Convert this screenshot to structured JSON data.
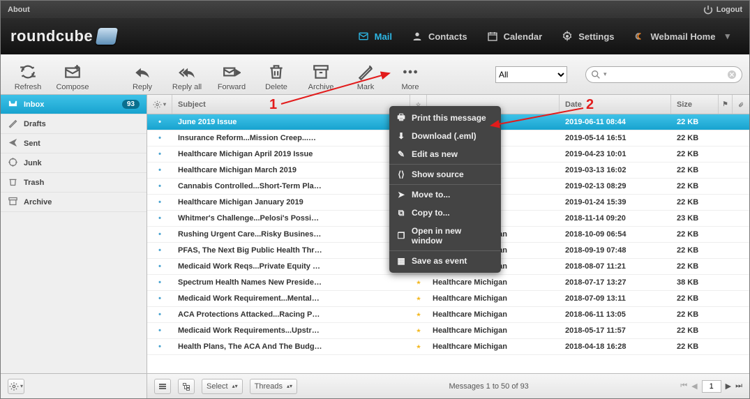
{
  "topbar": {
    "about": "About",
    "logout": "Logout"
  },
  "brand": "roundcube",
  "nav": {
    "mail": "Mail",
    "contacts": "Contacts",
    "calendar": "Calendar",
    "settings": "Settings",
    "webmail": "Webmail Home"
  },
  "toolbar": {
    "refresh": "Refresh",
    "compose": "Compose",
    "reply": "Reply",
    "replyall": "Reply all",
    "forward": "Forward",
    "delete": "Delete",
    "archive": "Archive",
    "mark": "Mark",
    "more": "More"
  },
  "filter_selected": "All",
  "folders": [
    {
      "key": "inbox",
      "label": "Inbox",
      "badge": "93",
      "active": true
    },
    {
      "key": "drafts",
      "label": "Drafts"
    },
    {
      "key": "sent",
      "label": "Sent"
    },
    {
      "key": "junk",
      "label": "Junk"
    },
    {
      "key": "trash",
      "label": "Trash"
    },
    {
      "key": "archive",
      "label": "Archive"
    }
  ],
  "columns": {
    "subject": "Subject",
    "date": "Date",
    "size": "Size"
  },
  "messages": [
    {
      "subject": "June 2019 Issue",
      "from": "",
      "date": "2019-06-11 08:44",
      "size": "22 KB",
      "starred": false,
      "selected": true
    },
    {
      "subject": "Insurance Reform...Mission Creep...…",
      "from": "",
      "date": "2019-05-14 16:51",
      "size": "22 KB",
      "starred": false
    },
    {
      "subject": "Healthcare Michigan April 2019 Issue",
      "from": "",
      "date": "2019-04-23 10:01",
      "size": "22 KB",
      "starred": false
    },
    {
      "subject": "Healthcare Michigan March 2019",
      "from": "",
      "date": "2019-03-13 16:02",
      "size": "22 KB",
      "starred": false
    },
    {
      "subject": "Cannabis Controlled...Short-Term Pla…",
      "from": "",
      "date": "2019-02-13 08:29",
      "size": "22 KB",
      "starred": false
    },
    {
      "subject": "Healthcare Michigan January 2019",
      "from": "",
      "date": "2019-01-24 15:39",
      "size": "22 KB",
      "starred": false
    },
    {
      "subject": "Whitmer's Challenge...Pelosi's Possi…",
      "from": "",
      "date": "2018-11-14 09:20",
      "size": "23 KB",
      "starred": false
    },
    {
      "subject": "Rushing Urgent Care...Risky Busines…",
      "from": "Healthcare Michigan",
      "date": "2018-10-09 06:54",
      "size": "22 KB",
      "starred": true
    },
    {
      "subject": "PFAS, The Next Big Public Health Thr…",
      "from": "Healthcare Michigan",
      "date": "2018-09-19 07:48",
      "size": "22 KB",
      "starred": true
    },
    {
      "subject": "Medicaid Work Reqs...Private Equity …",
      "from": "Healthcare Michigan",
      "date": "2018-08-07 11:21",
      "size": "22 KB",
      "starred": true
    },
    {
      "subject": "Spectrum Health Names New Preside…",
      "from": "Healthcare Michigan",
      "date": "2018-07-17 13:27",
      "size": "38 KB",
      "starred": true
    },
    {
      "subject": "Medicaid Work Requirement...Mental…",
      "from": "Healthcare Michigan",
      "date": "2018-07-09 13:11",
      "size": "22 KB",
      "starred": true
    },
    {
      "subject": "ACA Protections Attacked...Racing P…",
      "from": "Healthcare Michigan",
      "date": "2018-06-11 13:05",
      "size": "22 KB",
      "starred": true
    },
    {
      "subject": "Medicaid Work Requirements...Upstr…",
      "from": "Healthcare Michigan",
      "date": "2018-05-17 11:57",
      "size": "22 KB",
      "starred": true
    },
    {
      "subject": "Health Plans, The ACA And The Budg…",
      "from": "Healthcare Michigan",
      "date": "2018-04-18 16:28",
      "size": "22 KB",
      "starred": true
    }
  ],
  "footer": {
    "select": "Select",
    "threads": "Threads",
    "status": "Messages 1 to 50 of 93",
    "page": "1"
  },
  "ctxmenu": {
    "print": "Print this message",
    "download": "Download (.eml)",
    "editnew": "Edit as new",
    "source": "Show source",
    "moveto": "Move to...",
    "copyto": "Copy to...",
    "newwin": "Open in new window",
    "event": "Save as event"
  },
  "annotations": {
    "one": "1",
    "two": "2"
  }
}
